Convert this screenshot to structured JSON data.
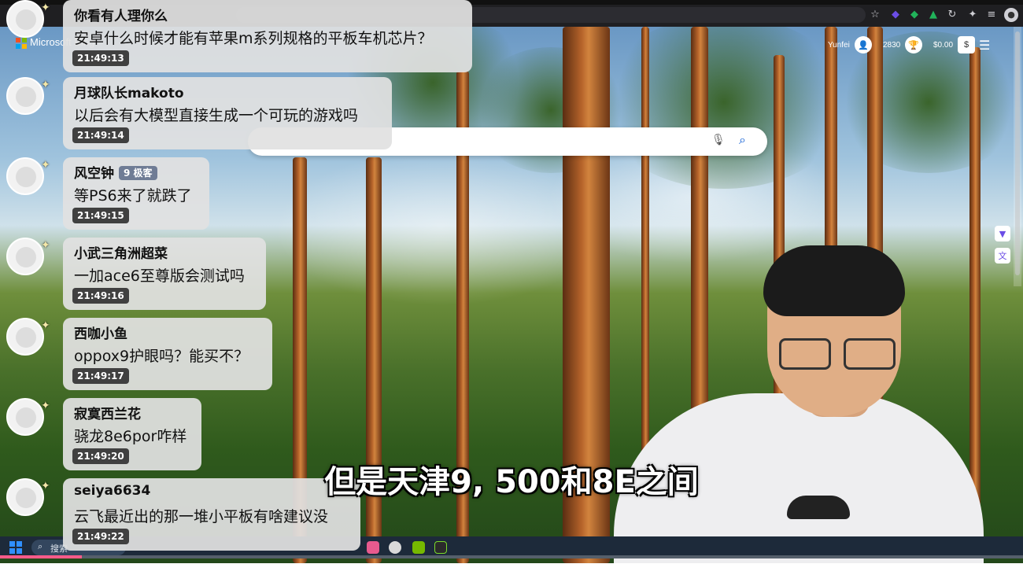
{
  "browser": {
    "search_placeholder": "",
    "brand": "Microsoft Bing",
    "user_name": "Yunfei",
    "points": "2830",
    "balance": "$0.00"
  },
  "taskbar": {
    "search_label": "搜索"
  },
  "chat": {
    "messages": [
      {
        "user": "你看有人理你么",
        "badge": "",
        "text": "安卓什么时候才能有苹果m系列规格的平板车机芯片？",
        "time": "21:49:13"
      },
      {
        "user": "月球队长makoto",
        "badge": "",
        "text": "以后会有大模型直接生成一个可玩的游戏吗",
        "time": "21:49:14"
      },
      {
        "user": "风空钟",
        "badge": "9 极客",
        "text": "等PS6来了就跌了",
        "time": "21:49:15"
      },
      {
        "user": "小武三角洲超菜",
        "badge": "",
        "text": "一加ace6至尊版会测试吗",
        "time": "21:49:16"
      },
      {
        "user": "西咖小鱼",
        "badge": "",
        "text": "oppox9护眼吗？能买不？",
        "time": "21:49:17"
      },
      {
        "user": "寂寞西兰花",
        "badge": "",
        "text": "骁龙8e6por咋样",
        "time": "21:49:20"
      },
      {
        "user": "seiya6634",
        "badge": "",
        "text": "云飞最近出的那一堆小平板有啥建议没",
        "time": "21:49:22"
      }
    ]
  },
  "subtitle": "但是天津9, 500和8E之间",
  "playback": {
    "progress": 0.08
  },
  "colors": {
    "progress": "#ff5b8a",
    "chat_bubble": "#e1e1e1",
    "time_badge": "#404040"
  }
}
